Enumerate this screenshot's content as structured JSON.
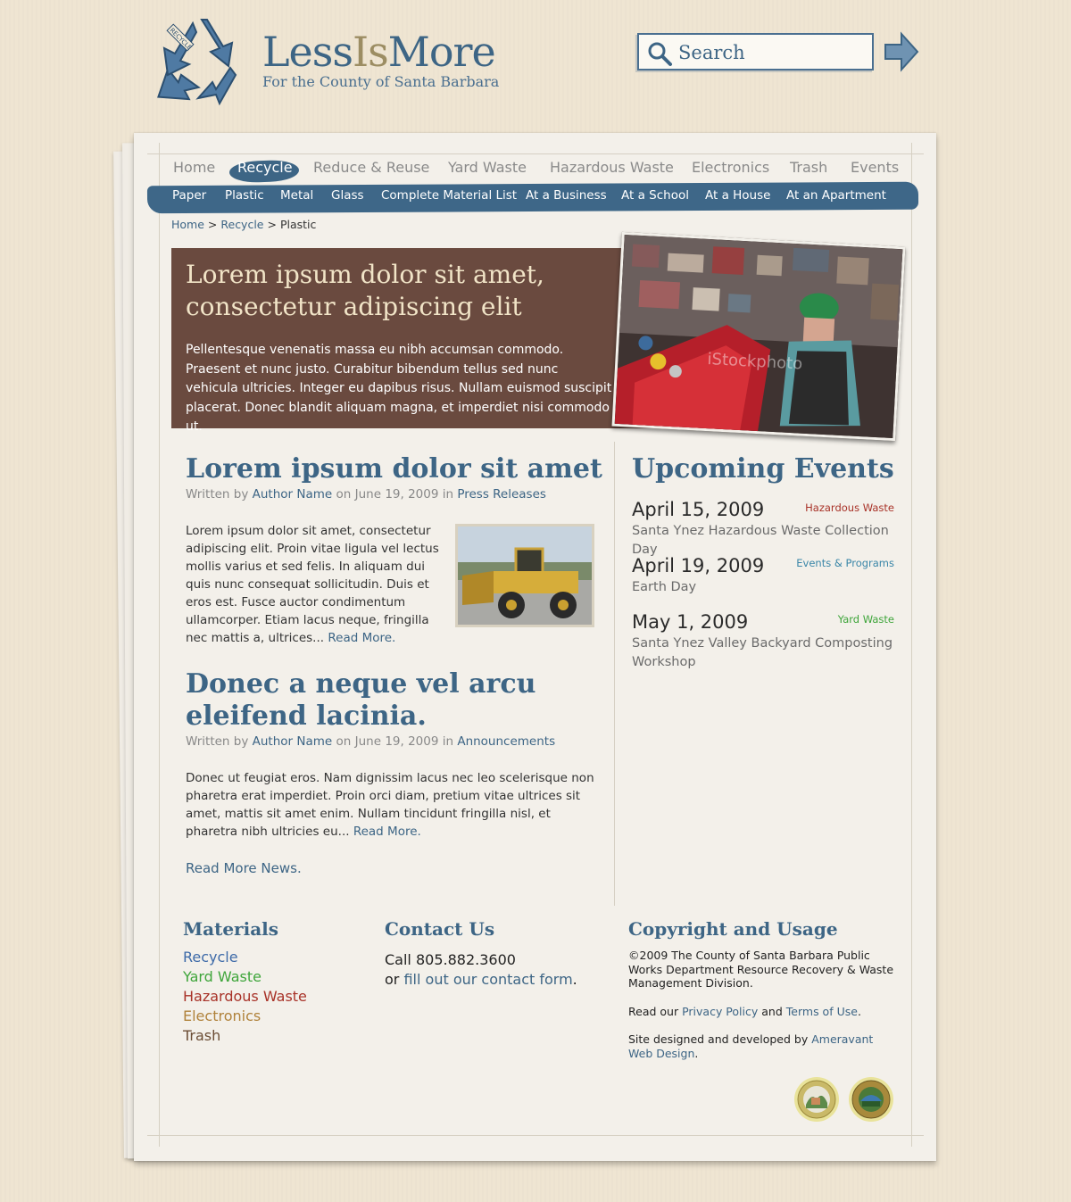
{
  "header": {
    "logo_less": "Less",
    "logo_is": "Is",
    "logo_more": "More",
    "tagline": "For the County of Santa Barbara",
    "search_placeholder": "Search"
  },
  "main_nav": [
    {
      "label": "Home",
      "active": false
    },
    {
      "label": "Recycle",
      "active": true
    },
    {
      "label": "Reduce & Reuse",
      "active": false
    },
    {
      "label": "Yard Waste",
      "active": false
    },
    {
      "label": "Hazardous Waste",
      "active": false
    },
    {
      "label": "Electronics",
      "active": false
    },
    {
      "label": "Trash",
      "active": false
    },
    {
      "label": "Events",
      "active": false
    }
  ],
  "sub_nav": [
    "Paper",
    "Plastic",
    "Metal",
    "Glass",
    "Complete Material List",
    "At a Business",
    "At a School",
    "At a House",
    "At an Apartment"
  ],
  "breadcrumb": {
    "home": "Home",
    "sep1": ">",
    "recycle": "Recycle",
    "sep2": ">",
    "current": "Plastic"
  },
  "hero": {
    "title": "Lorem ipsum dolor sit amet, consectetur adipiscing elit",
    "text": "Pellentesque venenatis massa eu nibh accumsan commodo. Praesent et nunc justo. Curabitur bibendum tellus sed nunc vehicula ultricies. Integer eu dapibus risus. Nullam euismod suscipit placerat. Donec blandit aliquam magna, et imperdiet nisi commodo ut.",
    "photo_watermark": "iStockphoto"
  },
  "articles": [
    {
      "title": "Lorem ipsum dolor sit amet",
      "written_by": "Written by",
      "author": "Author Name",
      "on": "on June 19, 2009 in",
      "category": "Press Releases",
      "body": "Lorem ipsum dolor sit amet, consectetur adipiscing elit. Proin vitae ligula vel lectus mollis varius et sed felis. In aliquam dui quis nunc consequat sollicitudin. Duis et eros est. Fusce auctor condimentum ullamcorper. Etiam lacus neque, fringilla nec mattis a, ultrices...",
      "read_more": "Read More."
    },
    {
      "title": "Donec a neque vel arcu eleifend lacinia.",
      "written_by": "Written by",
      "author": "Author Name",
      "on": "on June 19, 2009 in",
      "category": "Announcements",
      "body": "Donec ut feugiat eros. Nam dignissim lacus nec leo scelerisque non pharetra erat imperdiet. Proin orci diam, pretium vitae ultrices sit amet, mattis sit amet enim. Nullam tincidunt fringilla nisl, et pharetra nibh ultricies eu...",
      "read_more": "Read More."
    }
  ],
  "read_more_news": "Read More News.",
  "events": {
    "title": "Upcoming Events",
    "items": [
      {
        "date": "April 15, 2009",
        "category": "Hazardous Waste",
        "category_color": "#a83228",
        "desc": "Santa Ynez Hazardous Waste Collection Day"
      },
      {
        "date": "April 19, 2009",
        "category": "Events & Programs",
        "category_color": "#3a86a8",
        "desc": "Earth Day"
      },
      {
        "date": "May 1, 2009",
        "category": "Yard Waste",
        "category_color": "#3ea53a",
        "desc": "Santa Ynez Valley Backyard Composting Workshop"
      }
    ]
  },
  "footer": {
    "materials_title": "Materials",
    "materials": [
      {
        "label": "Recycle",
        "color": "#3d6aa8"
      },
      {
        "label": "Yard Waste",
        "color": "#3ea53a"
      },
      {
        "label": "Hazardous Waste",
        "color": "#a83228"
      },
      {
        "label": "Electronics",
        "color": "#b0823b"
      },
      {
        "label": "Trash",
        "color": "#6b4d35"
      }
    ],
    "contact_title": "Contact Us",
    "contact_call": "Call 805.882.3600",
    "contact_or": "or",
    "contact_link": "fill out our contact form",
    "contact_period": ".",
    "copyright_title": "Copyright and Usage",
    "copyright_text": "©2009 The County of Santa Barbara Public Works Department Resource Recovery & Waste Management Division.",
    "read_our": "Read our",
    "privacy": "Privacy Policy",
    "and": "and",
    "terms": "Terms of Use",
    "terms_period": ".",
    "designed_by": "Site designed and developed by",
    "designer": "Ameravant Web Design",
    "designer_period": "."
  },
  "colors": {
    "brand_blue": "#3d6585",
    "hero_brown": "#6a4a3f",
    "nav_bar": "#3e6788"
  }
}
